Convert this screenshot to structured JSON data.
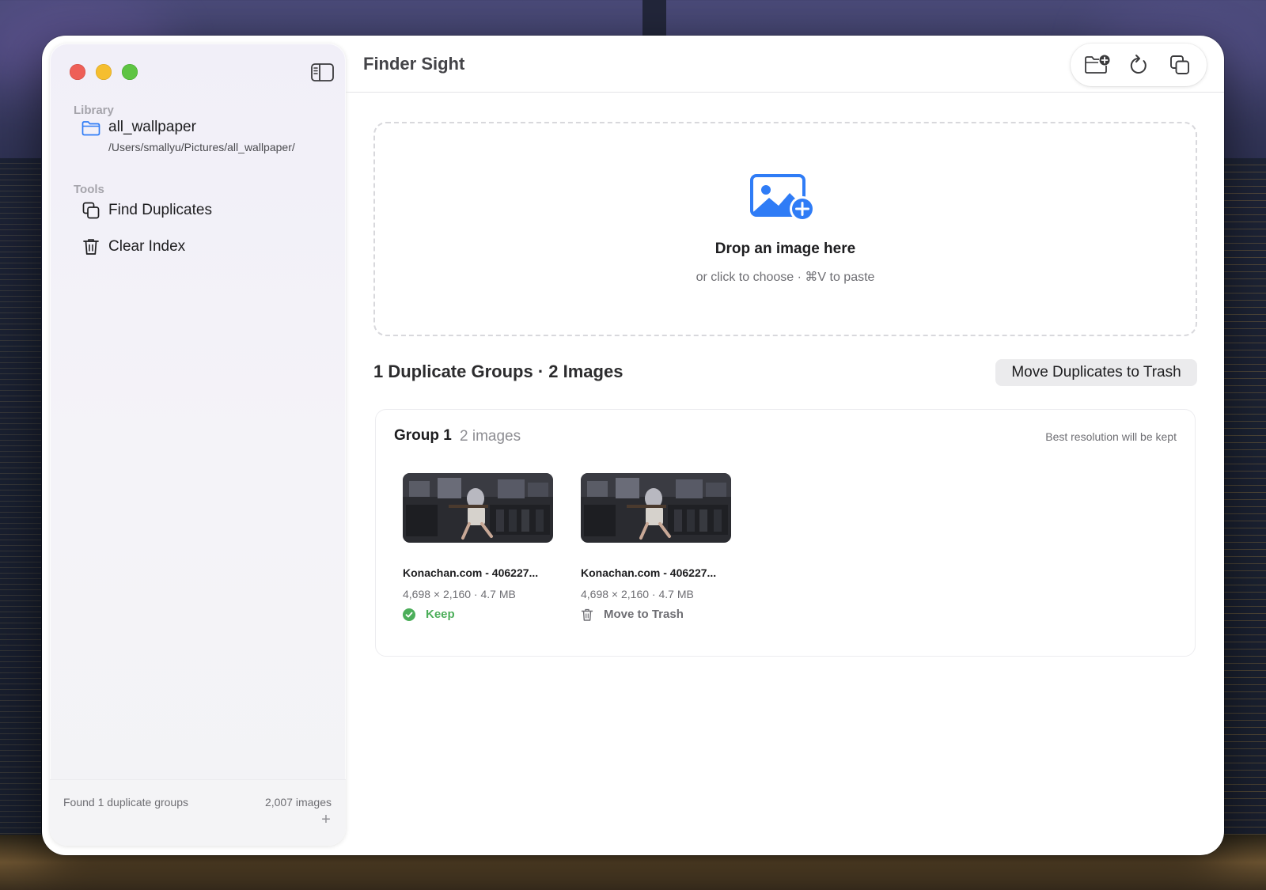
{
  "colors": {
    "accent": "#2f7cf6",
    "keep_green": "#4cae5a",
    "traffic_red": "#ee5f57",
    "traffic_yellow": "#f5be2f",
    "traffic_green": "#5ec443"
  },
  "sidebar": {
    "library_header": "Library",
    "library_item": {
      "icon": "folder-icon",
      "name": "all_wallpaper",
      "path": "/Users/smallyu/Pictures/all_wallpaper/"
    },
    "tools_header": "Tools",
    "tools": [
      {
        "icon": "duplicates-icon",
        "label": "Find Duplicates"
      },
      {
        "icon": "trash-icon",
        "label": "Clear Index"
      }
    ],
    "footer": {
      "status": "Found 1 duplicate groups",
      "count": "2,007 images",
      "add": "+"
    }
  },
  "header": {
    "title": "Finder Sight",
    "toolbar": [
      "add-folder-icon",
      "refresh-icon",
      "duplicates-icon"
    ]
  },
  "dropzone": {
    "title": "Drop an image here",
    "subtitle": "or click to choose · ⌘V to paste"
  },
  "results": {
    "summary": "1 Duplicate Groups · 2 Images",
    "trash_button": "Move Duplicates to Trash",
    "groups": [
      {
        "title": "Group 1",
        "count": "2 images",
        "note": "Best resolution will be kept",
        "items": [
          {
            "name": "Konachan.com - 406227...",
            "meta": "4,698 × 2,160 · 4.7 MB",
            "action": "Keep",
            "action_icon": "checkmark-circle-icon"
          },
          {
            "name": "Konachan.com - 406227...",
            "meta": "4,698 × 2,160 · 4.7 MB",
            "action": "Move to Trash",
            "action_icon": "trash-icon"
          }
        ]
      }
    ]
  }
}
